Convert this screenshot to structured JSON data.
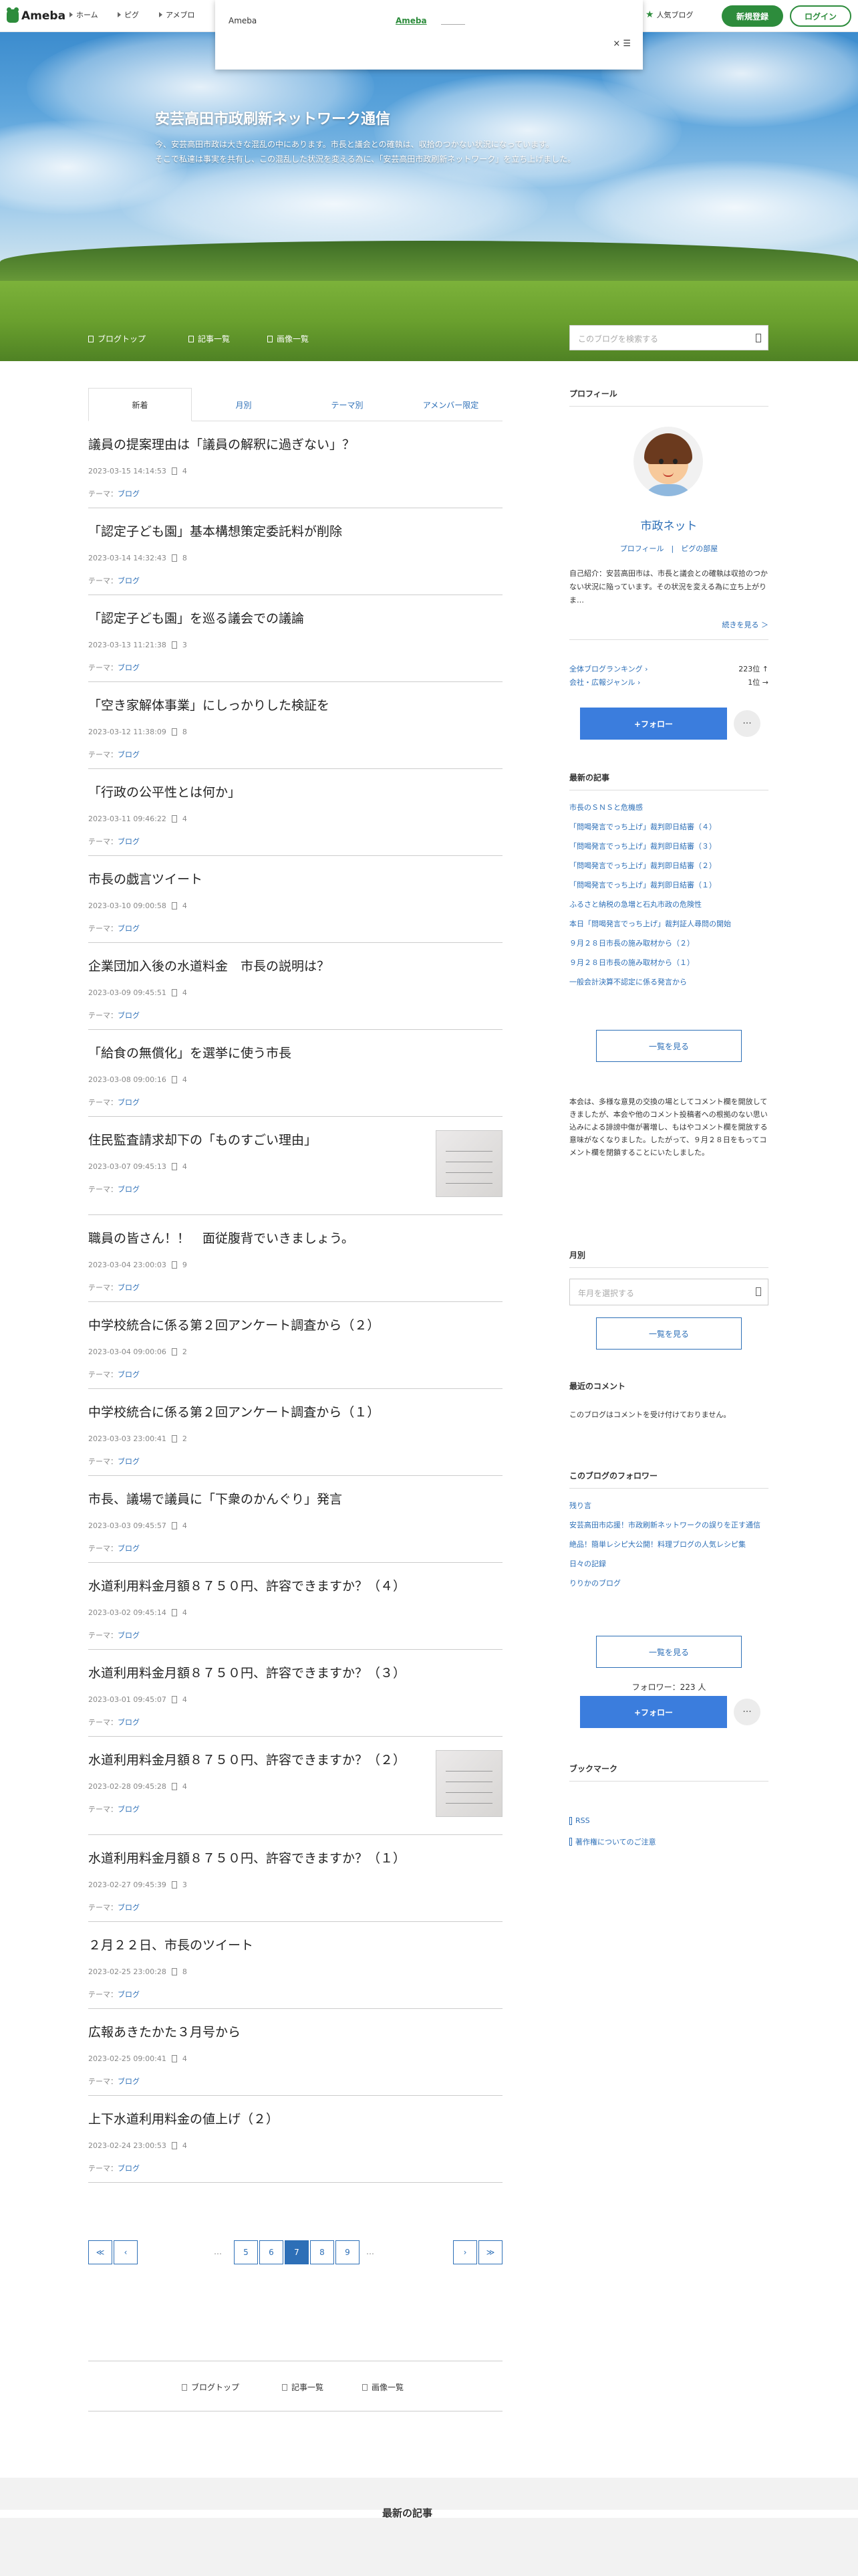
{
  "topbar": {
    "logo": "Ameba",
    "links": [
      "ホーム",
      "ピグ",
      "アメブロ"
    ],
    "popup_left": "Ameba",
    "popup_link": "Ameba",
    "popup_close": "× ☰",
    "popular": "人気ブログ",
    "register": "新規登録",
    "login": "ログイン"
  },
  "hero": {
    "title": "安芸高田市政刷新ネットワーク通信",
    "desc1": "今、安芸高田市政は大きな混乱の中にあります。市長と議会との確執は、収拾のつかない状況になっています。",
    "desc2": "そこで私達は事実を共有し、この混乱した状況を変える為に、「安芸高田市政刷新ネットワーク」を立ち上げました。"
  },
  "nav": {
    "items": [
      "ブログトップ",
      "記事一覧",
      "画像一覧"
    ],
    "search_placeholder": "このブログを検索する"
  },
  "tabs": [
    "新着",
    "月別",
    "テーマ別",
    "アメンバー限定"
  ],
  "theme_prefix": "テーマ：",
  "theme_value": "ブログ",
  "entries": [
    {
      "title": "議員の提案理由は「議員の解釈に過ぎない」？",
      "date": "2023-03-15 14:14:53",
      "comments": "4"
    },
    {
      "title": "「認定子ども園」基本構想策定委託料が削除",
      "date": "2023-03-14 14:32:43",
      "comments": "8"
    },
    {
      "title": "「認定子ども園」を巡る議会での議論",
      "date": "2023-03-13 11:21:38",
      "comments": "3"
    },
    {
      "title": "「空き家解体事業」にしっかりした検証を",
      "date": "2023-03-12 11:38:09",
      "comments": "8"
    },
    {
      "title": "「行政の公平性とは何か」",
      "date": "2023-03-11 09:46:22",
      "comments": "4"
    },
    {
      "title": "市長の戯言ツイート",
      "date": "2023-03-10 09:00:58",
      "comments": "4"
    },
    {
      "title": "企業団加入後の水道料金　市長の説明は？",
      "date": "2023-03-09 09:45:51",
      "comments": "4"
    },
    {
      "title": "「給食の無償化」を選挙に使う市長",
      "date": "2023-03-08 09:00:16",
      "comments": "4"
    },
    {
      "title": "住民監査請求却下の「ものすごい理由」",
      "date": "2023-03-07 09:45:13",
      "comments": "4",
      "thumb": true
    },
    {
      "title": "職員の皆さん！！　面従腹背でいきましょう。",
      "date": "2023-03-04 23:00:03",
      "comments": "9"
    },
    {
      "title": "中学校統合に係る第２回アンケート調査から（２）",
      "date": "2023-03-04 09:00:06",
      "comments": "2"
    },
    {
      "title": "中学校統合に係る第２回アンケート調査から（１）",
      "date": "2023-03-03 23:00:41",
      "comments": "2"
    },
    {
      "title": "市長、議場で議員に「下衆のかんぐり」発言",
      "date": "2023-03-03 09:45:57",
      "comments": "4"
    },
    {
      "title": "水道利用料金月額８７５０円、許容できますか？（４）",
      "date": "2023-03-02 09:45:14",
      "comments": "4"
    },
    {
      "title": "水道利用料金月額８７５０円、許容できますか？（３）",
      "date": "2023-03-01 09:45:07",
      "comments": "4"
    },
    {
      "title": "水道利用料金月額８７５０円、許容できますか？（２）",
      "date": "2023-02-28 09:45:28",
      "comments": "4",
      "thumb": true
    },
    {
      "title": "水道利用料金月額８７５０円、許容できますか？（１）",
      "date": "2023-02-27 09:45:39",
      "comments": "3"
    },
    {
      "title": "２月２２日、市長のツイート",
      "date": "2023-02-25 23:00:28",
      "comments": "8"
    },
    {
      "title": "広報あきたかた３月号から",
      "date": "2023-02-25 09:00:41",
      "comments": "4"
    },
    {
      "title": "上下水道利用料金の値上げ（２）",
      "date": "2023-02-24 23:00:53",
      "comments": "4"
    }
  ],
  "pager": {
    "pages": [
      "5",
      "6",
      "7",
      "8",
      "9"
    ],
    "current": "7",
    "dots": "…",
    "first": "≪",
    "prev": "‹",
    "next": "›",
    "last": "≫"
  },
  "profile": {
    "heading": "プロフィール",
    "name": "市政ネット",
    "links": "プロフィール　|　ピグの部屋",
    "intro": "自己紹介：安芸高田市は、市長と議会との確執は収拾のつかない状況に陥っています。その状況を変える為に立ち上がりま…",
    "more": "続きを見る ＞",
    "rank1_label": "全体ブログランキング ›",
    "rank1_value": "223位 ↑",
    "rank2_label": "会社・広報ジャンル ›",
    "rank2_value": "1位 →",
    "follow": "+フォロー",
    "more_btn": "···"
  },
  "recent": {
    "heading": "最新の記事",
    "items": [
      "市長のＳＮＳと危機感",
      "「問喝発言でっち上げ」裁判即日結審（４）",
      "「問喝発言でっち上げ」裁判即日結審（３）",
      "「問喝発言でっち上げ」裁判即日結審（２）",
      "「問喝発言でっち上げ」裁判即日結審（１）",
      "ふるさと納税の急増と石丸市政の危険性",
      "本日「問喝発言でっち上げ」裁判証人尋問の開始",
      "９月２８日市長の施み取材から（２）",
      "９月２８日市長の施み取材から（１）",
      "一般会計決算不認定に係る発言から"
    ],
    "button": "一覧を見る"
  },
  "notice": "本会は、多様な意見の交換の場としてコメント欄を開放してきましたが、本会や他のコメント投稿者への根拠のない思い込みによる誹謗中傷が著増し、もはやコメント欄を開放する意味がなくなりました。したがって、９月２８日をもってコメント欄を閉鎖することにいたしました。",
  "monthly": {
    "heading": "月別",
    "placeholder": "年月を選択する",
    "button": "一覧を見る"
  },
  "comments_section": {
    "heading": "最近のコメント",
    "text": "このブログはコメントを受け付けておりません。"
  },
  "followers": {
    "heading": "このブログのフォロワー",
    "items": [
      "残り言",
      "安芸高田市応援！市政刷新ネットワークの誤りを正す通信",
      "絶品！簡単レシピ大公開！料理ブログの人気レシピ集",
      "日々の記録",
      "りりかのブログ"
    ],
    "button": "一覧を見る",
    "count": "フォロワー：223 人",
    "follow": "+フォロー",
    "more_btn": "···"
  },
  "bookmarks": {
    "heading": "ブックマーク",
    "items": [
      "RSS",
      "著作権についてのご注意"
    ]
  },
  "footer_nav": [
    "ブログトップ",
    "記事一覧",
    "画像一覧"
  ],
  "bottom": {
    "heading": "最新の記事"
  },
  "colors": {
    "accent": "#2d8c3c",
    "link": "#2d6fb7",
    "follow": "#3b7ddd"
  }
}
